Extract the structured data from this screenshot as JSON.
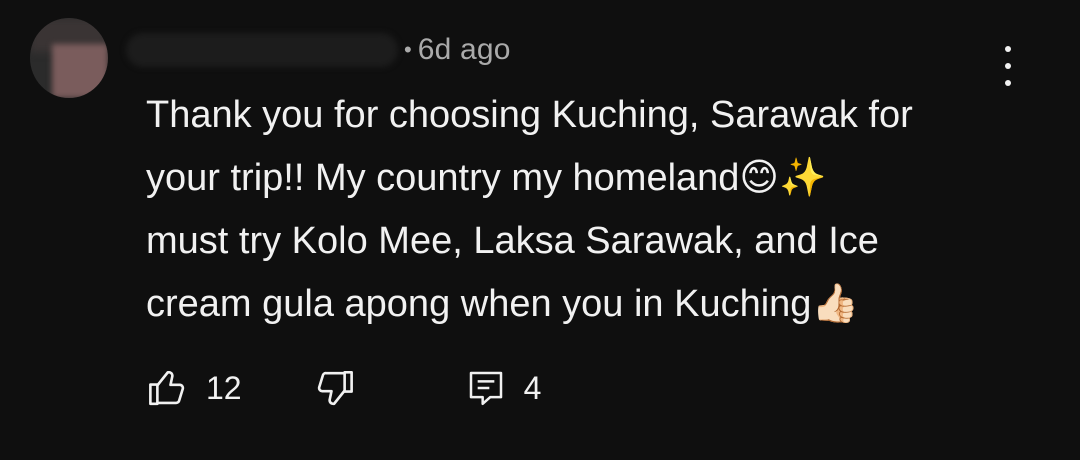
{
  "comment": {
    "time": "6d ago",
    "separator": "•",
    "text_lines": [
      "Thank you for choosing Kuching, Sarawak for",
      "your trip!! My country my homeland😊✨",
      "must try Kolo Mee, Laksa Sarawak, and Ice",
      "cream gula apong when you in Kuching👍🏻"
    ],
    "likes": "12",
    "replies": "4"
  },
  "icons": {
    "like": "thumbs-up-icon",
    "dislike": "thumbs-down-icon",
    "reply": "comment-icon",
    "more": "more-vert-icon"
  },
  "colors": {
    "background": "#0f0f0f",
    "text": "#f1f1f1",
    "meta": "#aaaaaa"
  }
}
